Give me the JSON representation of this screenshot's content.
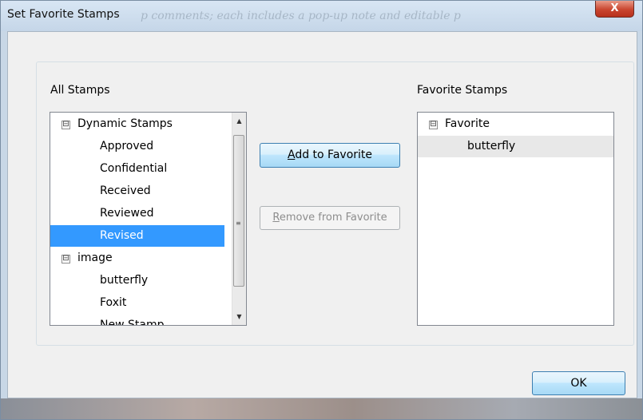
{
  "window": {
    "title": "Set Favorite Stamps",
    "background_text": "p comments; each includes a pop-up note and editable p",
    "close_label": "X"
  },
  "all_stamps": {
    "label": "All Stamps",
    "groups": [
      {
        "name": "Dynamic Stamps",
        "expander": "⊟",
        "items": [
          "Approved",
          "Confidential",
          "Received",
          "Reviewed",
          "Revised"
        ]
      },
      {
        "name": "image",
        "expander": "⊟",
        "items": [
          "butterfly",
          "Foxit",
          "New Stamp"
        ]
      }
    ],
    "selected_item": "Revised"
  },
  "buttons": {
    "add": {
      "underline": "A",
      "rest": "dd to Favorite"
    },
    "remove": {
      "underline": "R",
      "rest": "emove from Favorite"
    },
    "ok": "OK"
  },
  "favorite_stamps": {
    "label": "Favorite Stamps",
    "groups": [
      {
        "name": "Favorite",
        "expander": "⊟",
        "items": [
          "butterfly"
        ]
      }
    ]
  },
  "colors": {
    "selection": "#3399ff",
    "hover": "#e8e8e8"
  },
  "icons": {
    "scroll_up": "triangle-up",
    "scroll_down": "triangle-down",
    "expander": "minus-box"
  }
}
